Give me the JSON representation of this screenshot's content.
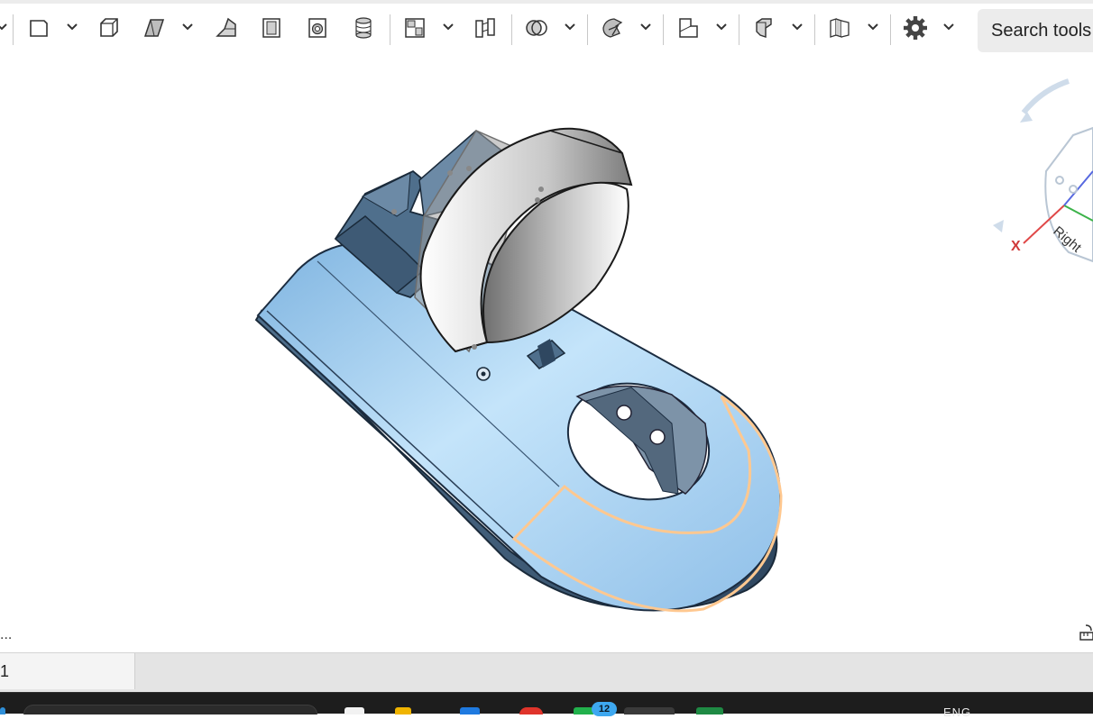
{
  "toolbar": {
    "tools": [
      {
        "name": "sketch-plane-icon",
        "has_menu": true
      },
      {
        "name": "extrude-icon",
        "has_menu": true
      },
      {
        "name": "revolve-icon",
        "has_menu": false
      },
      {
        "name": "sweep-icon",
        "has_menu": true
      },
      {
        "name": "loft-icon",
        "has_menu": false
      },
      {
        "name": "thicken-icon",
        "has_menu": false
      },
      {
        "name": "fillet-icon",
        "has_menu": false
      },
      {
        "name": "chamfer-icon",
        "has_menu": false
      },
      {
        "name": "draft-icon",
        "has_menu": true
      },
      {
        "name": "shell-icon",
        "has_menu": false
      },
      {
        "name": "boolean-icon",
        "has_menu": true
      },
      {
        "name": "transform-icon",
        "has_menu": true
      },
      {
        "name": "plane-icon",
        "has_menu": true
      },
      {
        "name": "sheet-metal-icon",
        "has_menu": true
      },
      {
        "name": "assembly-icon",
        "has_menu": true
      },
      {
        "name": "settings-gear-icon",
        "has_menu": true
      }
    ],
    "search_label": "Search tools"
  },
  "viewport": {
    "view_cube": {
      "face_label": "Right",
      "axis_label": "X"
    },
    "overflow_label": "..."
  },
  "tabs": [
    {
      "label": "1"
    }
  ],
  "taskbar": {
    "badge_count": "12",
    "language": "ENG"
  },
  "colors": {
    "model_blue": "#8fc4ec",
    "model_dark": "#4f6f8c",
    "selection_orange": "#ffc890",
    "toolbar_separator": "#c8c8c8",
    "taskbar_bg": "#1d1d1d"
  }
}
